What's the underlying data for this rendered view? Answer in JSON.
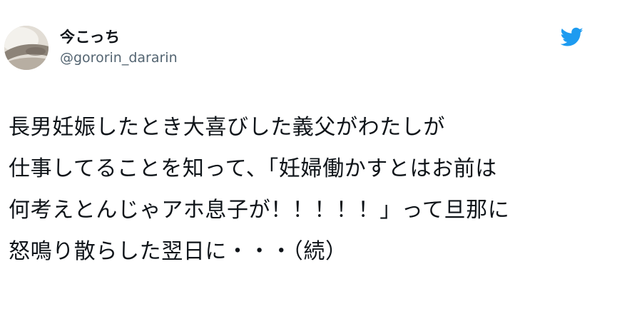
{
  "tweet": {
    "author": {
      "display_name": "今こっち",
      "username": "@gororin_dararin",
      "avatar_icon": "avatar-photo"
    },
    "brand_icon": "twitter-bird-icon",
    "brand_color": "#1d9bf0",
    "text_color": "#0f1419",
    "username_color": "#536471",
    "body_lines": [
      "長男妊娠したとき大喜びした義父がわたしが",
      "仕事してることを知って、「妊婦働かすとはお前は",
      "何考えとんじゃアホ息子が！！！！！」って旦那に",
      "怒鳴り散らした翌日に・・・（続）"
    ]
  }
}
